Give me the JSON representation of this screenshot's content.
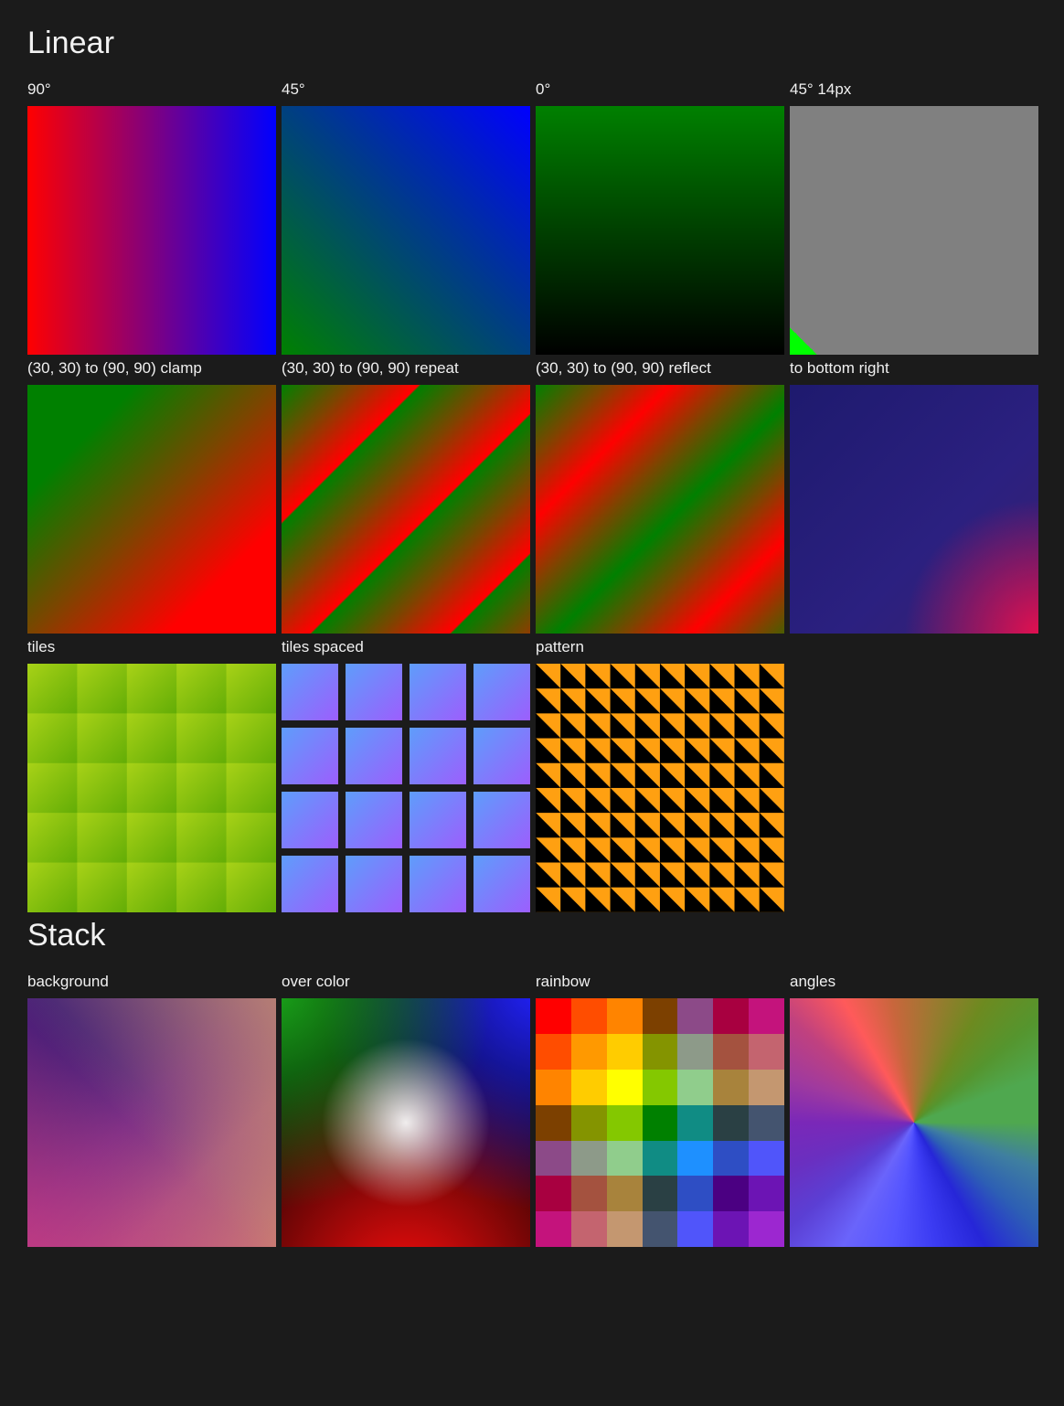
{
  "sections": [
    {
      "heading": "Linear",
      "rows": [
        [
          {
            "label": "90°",
            "kind": "sw-90deg"
          },
          {
            "label": "45°",
            "kind": "sw-45deg"
          },
          {
            "label": "0°",
            "kind": "sw-0deg"
          },
          {
            "label": "45° 14px",
            "kind": "sw-45px"
          }
        ],
        [
          {
            "label": "(30, 30) to (90, 90) clamp",
            "kind": "sw-clamp"
          },
          {
            "label": "(30, 30) to (90, 90) repeat",
            "kind": "sw-repeat"
          },
          {
            "label": "(30, 30) to (90, 90) reflect",
            "kind": "sw-reflect"
          },
          {
            "label": "to bottom right",
            "kind": "sw-bottomright"
          }
        ],
        [
          {
            "label": "tiles",
            "kind": "sw-tiles"
          },
          {
            "label": "tiles spaced",
            "kind": "sw-tilesspaced"
          },
          {
            "label": "pattern",
            "kind": "sw-pattern"
          }
        ]
      ]
    },
    {
      "heading": "Stack",
      "rows": [
        [
          {
            "label": "background",
            "kind": "sw-background"
          },
          {
            "label": "over color",
            "kind": "sw-overcolor"
          },
          {
            "label": "rainbow",
            "kind": "sw-rainbow"
          },
          {
            "label": "angles",
            "kind": "sw-angles"
          }
        ]
      ]
    }
  ],
  "palette": {
    "page_background": "#1b1b1b",
    "label_color": "#f0f0f0",
    "heading_color": "#f2f2f2"
  },
  "chart_data": {
    "type": "heatmap",
    "title": "rainbow",
    "description": "7x7 blend matrix of seven base hues blended pairwise",
    "base_colors": [
      "#ff0000",
      "#ff8800",
      "#ffcc00",
      "#008000",
      "#1e90ff",
      "#4b0082",
      "#9c27d0"
    ],
    "grid": [
      [
        "#ff0000",
        "#ff4d00",
        "#ff8400",
        "#7c4000",
        "#8c4a88",
        "#a80040",
        "#c4137c"
      ],
      [
        "#ff4d00",
        "#ff9900",
        "#ffcc00",
        "#849400",
        "#8d9a89",
        "#a4523f",
        "#c4646f"
      ],
      [
        "#ff8400",
        "#ffcc00",
        "#ffff00",
        "#84c800",
        "#90cd8c",
        "#a8833c",
        "#c49770"
      ],
      [
        "#7c4000",
        "#849400",
        "#84c800",
        "#008000",
        "#108c84",
        "#2a4044",
        "#44546f"
      ],
      [
        "#8c4a88",
        "#8d9a89",
        "#90cd8c",
        "#108c84",
        "#1e90ff",
        "#2e4ec4",
        "#5055fa"
      ],
      [
        "#a80040",
        "#a4523f",
        "#a8833c",
        "#2a4044",
        "#2e4ec4",
        "#4b0082",
        "#6c14b4"
      ],
      [
        "#c4137c",
        "#c4646f",
        "#c49770",
        "#44546f",
        "#5055fa",
        "#6c14b4",
        "#9c27d0"
      ]
    ]
  }
}
